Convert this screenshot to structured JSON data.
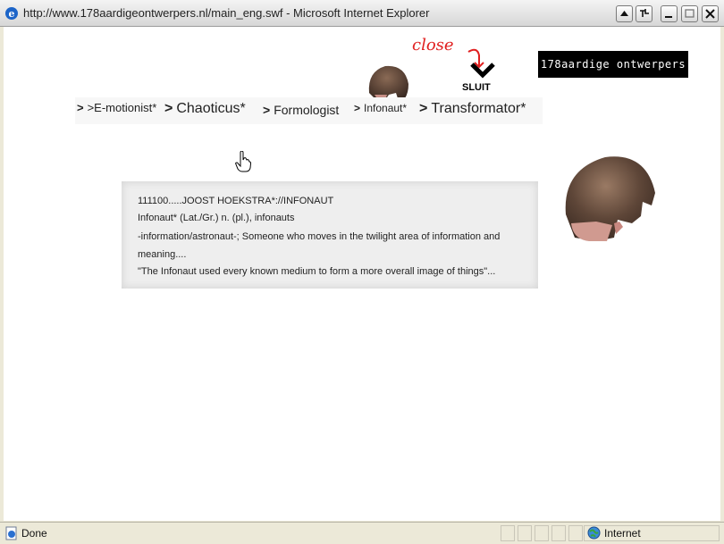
{
  "window": {
    "title": "http://www.178aardigeontwerpers.nl/main_eng.swf - Microsoft Internet Explorer",
    "controls": [
      "scroll-up",
      "pin",
      "minimize",
      "maximize",
      "close"
    ]
  },
  "page": {
    "nav": [
      {
        "label": ">E-motionist*"
      },
      {
        "label": "Chaoticus*"
      },
      {
        "label": "Formologist"
      },
      {
        "label": "Infonaut*"
      },
      {
        "label": "Transformator*"
      }
    ],
    "close_note": "close",
    "sluit_label": "SLUIT",
    "logo_text": "178aardige ontwerpers",
    "definition": {
      "line1": "111100.....JOOST HOEKSTRA*://INFONAUT",
      "line2": "Infonaut* (Lat./Gr.) n. (pl.), infonauts",
      "line3": "-information/astronaut-; Someone who moves in the twilight area of information and",
      "line4": "meaning....",
      "line5": "\"The Infonaut used every known medium to form a more overall image of things\"..."
    }
  },
  "statusbar": {
    "status": "Done",
    "zone": "Internet"
  },
  "colors": {
    "close_note": "#e02020",
    "logo_bg": "#000000",
    "content_bg": "#ffffff"
  }
}
